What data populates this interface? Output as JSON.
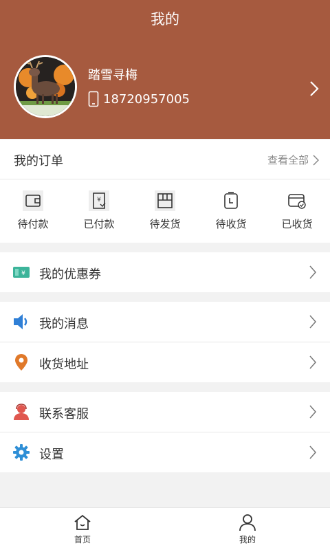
{
  "header": {
    "title": "我的"
  },
  "profile": {
    "username": "踏雪寻梅",
    "phone": "18720957005"
  },
  "orders": {
    "title": "我的订单",
    "view_all": "查看全部",
    "items": [
      {
        "label": "待付款",
        "icon": "wallet-icon"
      },
      {
        "label": "已付款",
        "icon": "receipt-paid-icon"
      },
      {
        "label": "待发货",
        "icon": "package-icon"
      },
      {
        "label": "待收货",
        "icon": "clock-box-icon"
      },
      {
        "label": "已收货",
        "icon": "card-check-icon"
      }
    ]
  },
  "menu": {
    "coupons": "我的优惠券",
    "messages": "我的消息",
    "address": "收货地址",
    "support": "联系客服",
    "settings": "设置"
  },
  "tabs": {
    "home": "首页",
    "mine": "我的"
  },
  "colors": {
    "brand": "#a65a3f",
    "coupon": "#3cb49a",
    "message": "#2f7fd6",
    "address": "#e0792a",
    "support": "#e0574f",
    "settings": "#2f8fd6"
  }
}
